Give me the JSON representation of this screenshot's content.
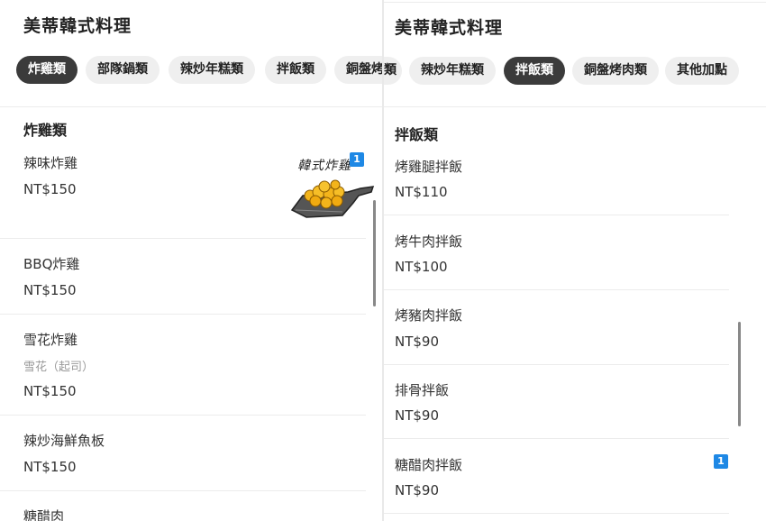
{
  "left": {
    "store_title": "美蒂韓式料理",
    "tabs": [
      "炸雞類",
      "部隊鍋類",
      "辣炒年糕類",
      "拌飯類",
      "銅盤烤"
    ],
    "section_title": "炸雞類",
    "items": [
      {
        "name": "辣味炸雞",
        "price": "NT$150",
        "badge": "1",
        "image_caption": "韓式炸雞"
      },
      {
        "name": "BBQ炸雞",
        "price": "NT$150"
      },
      {
        "name": "雪花炸雞",
        "desc": "雪花（起司）",
        "price": "NT$150"
      },
      {
        "name": "辣炒海鮮魚板",
        "price": "NT$150"
      },
      {
        "name": "糖醋肉"
      }
    ]
  },
  "right": {
    "store_title": "美蒂韓式料理",
    "tabs": [
      "類",
      "辣炒年糕類",
      "拌飯類",
      "銅盤烤肉類",
      "其他加點"
    ],
    "section_title": "拌飯類",
    "items": [
      {
        "name": "烤雞腿拌飯",
        "price": "NT$110"
      },
      {
        "name": "烤牛肉拌飯",
        "price": "NT$100"
      },
      {
        "name": "烤豬肉拌飯",
        "price": "NT$90"
      },
      {
        "name": "排骨拌飯",
        "price": "NT$90"
      },
      {
        "name": "糖醋肉拌飯",
        "price": "NT$90",
        "badge": "1"
      }
    ]
  },
  "colors": {
    "active_tab": "#3b3b3b",
    "inactive_tab": "#efefef",
    "badge": "#1e88e5"
  }
}
